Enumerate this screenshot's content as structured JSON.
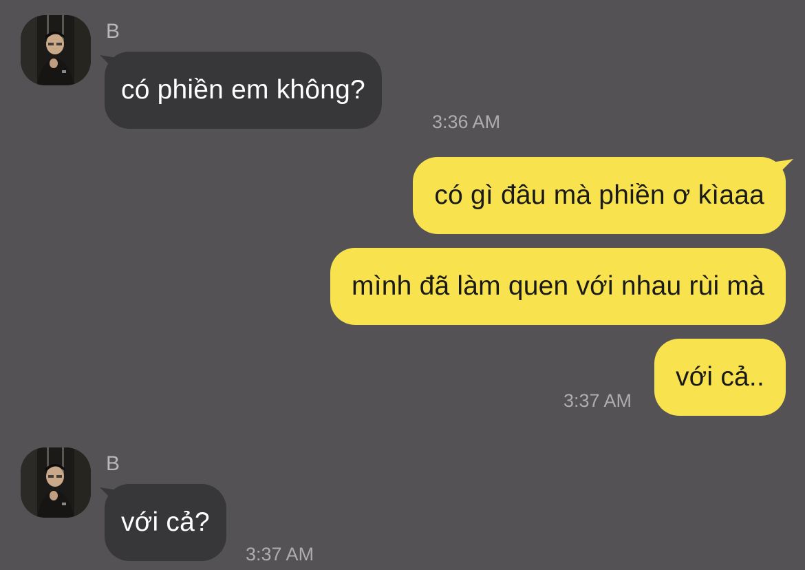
{
  "chat": {
    "colors": {
      "background": "#545255",
      "incoming_bubble": "#373639",
      "outgoing_bubble": "#f8e34e",
      "timestamp": "#aeacaf"
    },
    "messages": [
      {
        "sender": "B",
        "avatar": "profile-photo-icon",
        "text": "có phiền em không?",
        "time": "3:36 AM"
      },
      {
        "text": "có gì đâu mà phiền ơ kìaaa"
      },
      {
        "text": "mình đã làm quen với nhau rùi mà"
      },
      {
        "text": "với cả..",
        "time": "3:37 AM"
      },
      {
        "sender": "B",
        "avatar": "profile-photo-icon",
        "text": "với cả?",
        "time": "3:37 AM"
      }
    ]
  }
}
